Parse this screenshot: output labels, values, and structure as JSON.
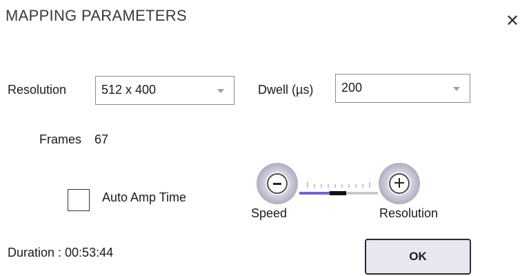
{
  "dialog": {
    "title": "MAPPING PARAMETERS",
    "close_glyph": "✕"
  },
  "resolution": {
    "label": "Resolution",
    "value": "512 x 400"
  },
  "dwell": {
    "label": "Dwell (µs)",
    "value": "200"
  },
  "frames": {
    "label": "Frames",
    "value": "67"
  },
  "auto_amp": {
    "label": "Auto Amp Time",
    "checked": false
  },
  "slider": {
    "left_label": "Speed",
    "right_label": "Resolution",
    "minus_icon": "minus-icon",
    "plus_icon": "plus-icon",
    "position_fraction": 0.42,
    "colors": {
      "fill": "#6f62d8",
      "track": "#c9c9c9",
      "thumb": "#111111"
    }
  },
  "duration": {
    "label": "Duration : 00:53:44"
  },
  "ok_button": {
    "label": "OK"
  }
}
